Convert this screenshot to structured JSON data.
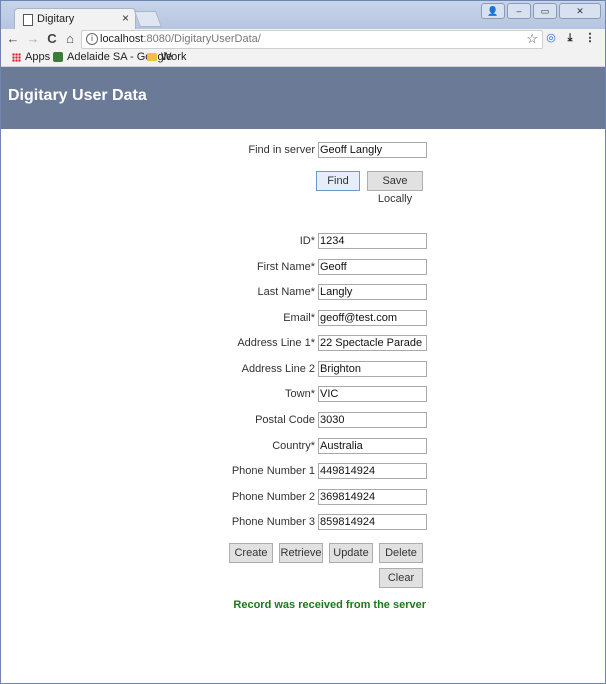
{
  "browser": {
    "tab_title": "Digitary",
    "tab_close": "×",
    "url_host": "localhost",
    "url_rest": ":8080/DigitaryUserData/",
    "bookmarks": [
      {
        "label": "Apps"
      },
      {
        "label": "Adelaide SA - Google"
      },
      {
        "label": "Work"
      }
    ],
    "nav": {
      "back": "←",
      "forward": "→",
      "reload": "C",
      "home": "⌂"
    },
    "star": "☆",
    "menu": "⋮",
    "download": "⤓"
  },
  "page": {
    "title": "Digitary User Data",
    "find": {
      "label": "Find in server",
      "value": "Geoff Langly",
      "find_button": "Find",
      "save_button": "Save Locally"
    },
    "fields": [
      {
        "label": "ID*",
        "value": "1234"
      },
      {
        "label": "First Name*",
        "value": "Geoff"
      },
      {
        "label": "Last Name*",
        "value": "Langly"
      },
      {
        "label": "Email*",
        "value": "geoff@test.com"
      },
      {
        "label": "Address Line 1*",
        "value": "22 Spectacle Parade"
      },
      {
        "label": "Address Line 2",
        "value": "Brighton"
      },
      {
        "label": "Town*",
        "value": "VIC"
      },
      {
        "label": "Postal Code",
        "value": "3030"
      },
      {
        "label": "Country*",
        "value": "Australia"
      },
      {
        "label": "Phone Number 1",
        "value": "449814924"
      },
      {
        "label": "Phone Number 2",
        "value": "369814924"
      },
      {
        "label": "Phone Number 3",
        "value": "859814924"
      }
    ],
    "actions": {
      "create": "Create",
      "retrieve": "Retrieve",
      "update": "Update",
      "delete": "Delete",
      "clear": "Clear"
    },
    "status": "Record was received from the server",
    "status_color": "#1a7a1a",
    "header_color": "#6b7a96"
  }
}
